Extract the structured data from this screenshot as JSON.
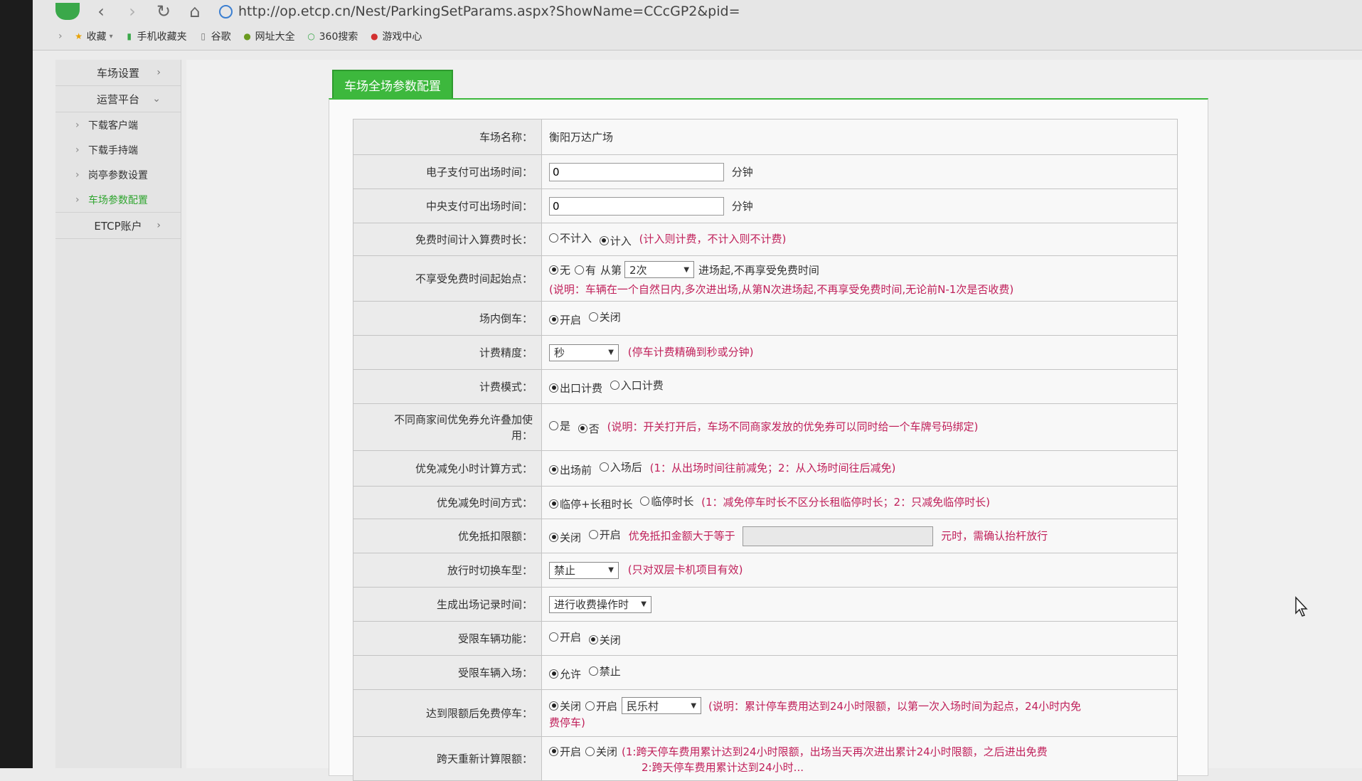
{
  "browser": {
    "url": "http://op.etcp.cn/Nest/ParkingSetParams.aspx?ShowName=CCcGP2&pid=",
    "favorites": [
      "收藏",
      "手机收藏夹",
      "谷歌",
      "网址大全",
      "360搜索",
      "游戏中心"
    ]
  },
  "sidebar": {
    "items": [
      {
        "label": "车场设置"
      },
      {
        "label": "运营平台"
      }
    ],
    "sub_items": [
      {
        "label": "下载客户端"
      },
      {
        "label": "下载手持端"
      },
      {
        "label": "岗亭参数设置"
      },
      {
        "label": "车场参数配置"
      }
    ],
    "etcp_label": "ETCP账户"
  },
  "panel": {
    "tab_label": "车场全场参数配置"
  },
  "form": {
    "r1": {
      "label": "车场名称：",
      "value": "衡阳万达广场"
    },
    "r2": {
      "label": "电子支付可出场时间：",
      "value": "0",
      "unit": "分钟"
    },
    "r3": {
      "label": "中央支付可出场时间：",
      "value": "0",
      "unit": "分钟"
    },
    "r4": {
      "label": "免费时间计入算费时长：",
      "opt1": "不计入",
      "opt2": "计入",
      "note": "(计入则计费，不计入则不计费)"
    },
    "r5": {
      "label": "不享受免费时间起始点：",
      "opt1": "无",
      "opt2": "有",
      "from": "从第",
      "select": "2次",
      "suffix": "进场起,不再享受免费时间",
      "note": "(说明：车辆在一个自然日内,多次进出场,从第N次进场起,不再享受免费时间,无论前N-1次是否收费)"
    },
    "r6": {
      "label": "场内倒车：",
      "opt1": "开启",
      "opt2": "关闭"
    },
    "r7": {
      "label": "计费精度：",
      "select": "秒",
      "note": "(停车计费精确到秒或分钟)"
    },
    "r8": {
      "label": "计费模式：",
      "opt1": "出口计费",
      "opt2": "入口计费"
    },
    "r9": {
      "label_line1": "不同商家间优免券允许叠加使",
      "label_line2": "用：",
      "opt1": "是",
      "opt2": "否",
      "note": "(说明：开关打开后，车场不同商家发放的优免券可以同时给一个车牌号码绑定)"
    },
    "r10": {
      "label": "优免减免小时计算方式：",
      "opt1": "出场前",
      "opt2": "入场后",
      "note": "(1：从出场时间往前减免；2：从入场时间往后减免)"
    },
    "r11": {
      "label": "优免减免时间方式：",
      "opt1": "临停+长租时长",
      "opt2": "临停时长",
      "note": "(1：减免停车时长不区分长租临停时长；2：只减免临停时长)"
    },
    "r12": {
      "label": "优免抵扣限额：",
      "opt1": "关闭",
      "opt2": "开启",
      "note1": "优免抵扣金额大于等于",
      "note2": "元时，需确认抬杆放行"
    },
    "r13": {
      "label": "放行时切换车型：",
      "select": "禁止",
      "note": "(只对双层卡机项目有效)"
    },
    "r14": {
      "label": "生成出场记录时间：",
      "select": "进行收费操作时"
    },
    "r15": {
      "label": "受限车辆功能：",
      "opt1": "开启",
      "opt2": "关闭"
    },
    "r16": {
      "label": "受限车辆入场：",
      "opt1": "允许",
      "opt2": "禁止"
    },
    "r17": {
      "label": "达到限额后免费停车：",
      "opt1": "关闭",
      "opt2": "开启",
      "select": "民乐村",
      "note_line1": "(说明：累计停车费用达到24小时限额，以第一次入场时间为起点，24小时内免",
      "note_line2": "费停车)"
    },
    "r18": {
      "label": "跨天重新计算限额：",
      "opt1": "开启",
      "opt2": "关闭",
      "note_line1": "(1:跨天停车费用累计达到24小时限额，出场当天再次进出累计24小时限额，之后进出免费",
      "note_line2": "2:跨天停车费用累计达到24小时..."
    }
  },
  "colors": {
    "accent": "#3db83d",
    "note": "#c0205a",
    "label_bg": "#ebebeb"
  }
}
